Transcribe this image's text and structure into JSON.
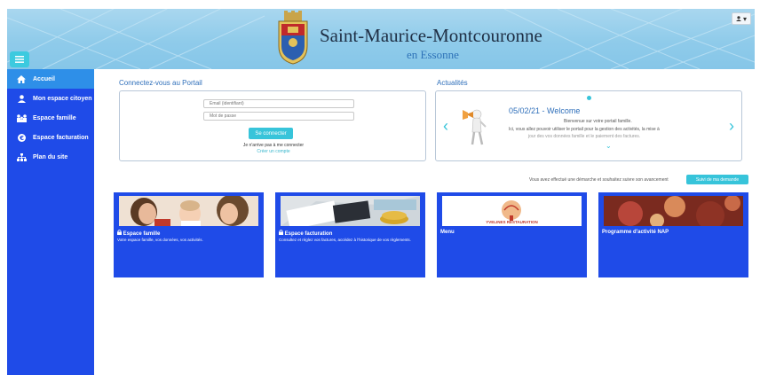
{
  "header": {
    "title": "Saint-Maurice-Montcouronne",
    "subtitle": "en Essonne",
    "user_menu": "▾"
  },
  "sidebar": {
    "items": [
      {
        "label": "Accueil",
        "icon": "home-icon",
        "active": true
      },
      {
        "label": "Mon espace citoyen",
        "icon": "user-icon",
        "active": false
      },
      {
        "label": "Espace famille",
        "icon": "family-icon",
        "active": false
      },
      {
        "label": "Espace facturation",
        "icon": "euro-icon",
        "active": false
      },
      {
        "label": "Plan du site",
        "icon": "sitemap-icon",
        "active": false
      }
    ]
  },
  "login": {
    "heading": "Connectez-vous au Portail",
    "email_placeholder": "Email (identifiant)",
    "password_placeholder": "Mot de passe",
    "submit_label": "Se connecter",
    "no_access_text": "Je n'arrive pas à me connecter",
    "create_account_link": "Créer un compte"
  },
  "news": {
    "heading": "Actualités",
    "date_title": "05/02/21 - Welcome",
    "line1": "Bienvenue sur votre portail famille.",
    "line2": "Ici, vous allez pouvoir utiliser le portail pour la gestion des activités, la mise à",
    "line3": "jour des vos données famille et le paiement des factures."
  },
  "tracking": {
    "text": "Vous avez effectué une démarche et souhaitez suivre son avancement",
    "button_label": "Suivi de ma demande"
  },
  "tiles": [
    {
      "title": "Espace famille",
      "description": "Votre espace famille, vos données, vos activités."
    },
    {
      "title": "Espace facturation",
      "description": "Consultez et réglez vos factures, accédez à l'historique de vos règlements."
    },
    {
      "title": "Menu",
      "description": "",
      "image_text": "YVELINES RESTAURATION"
    },
    {
      "title": "Programme d'activité NAP",
      "description": ""
    }
  ],
  "colors": {
    "sidebar": "#1f4be8",
    "accent": "#37c4da",
    "header": "#8fcbea",
    "link": "#2f6fba"
  }
}
